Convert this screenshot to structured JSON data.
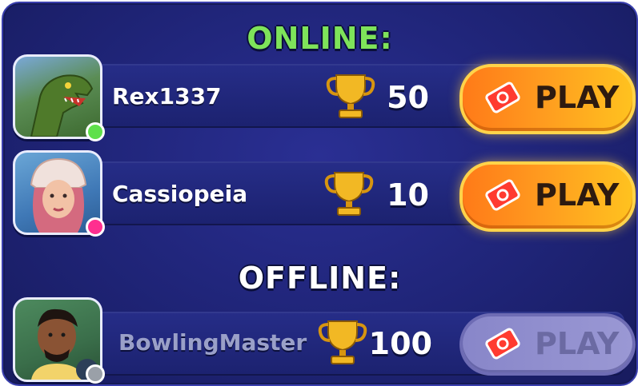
{
  "sections": {
    "online_title": "ONLINE:",
    "offline_title": "OFFLINE:"
  },
  "colors": {
    "online_title": "#7ee35a",
    "offline_title": "#ffffff",
    "online_status": "#5fe04a",
    "away_status": "#ff2f8f",
    "offline_status": "#9aa0a8",
    "play_active": "#ff9a1f",
    "play_disabled": "#9a98d4"
  },
  "players": [
    {
      "name": "Rex1337",
      "score": "50",
      "status": "online",
      "avatar": "t-rex-avatar",
      "play_label": "PLAY"
    },
    {
      "name": "Cassiopeia",
      "score": "10",
      "status": "online",
      "avatar": "winter-girl-avatar",
      "play_label": "PLAY"
    },
    {
      "name": "BowlingMaster",
      "score": "100",
      "status": "offline",
      "avatar": "bowler-avatar",
      "play_label": "PLAY"
    }
  ]
}
